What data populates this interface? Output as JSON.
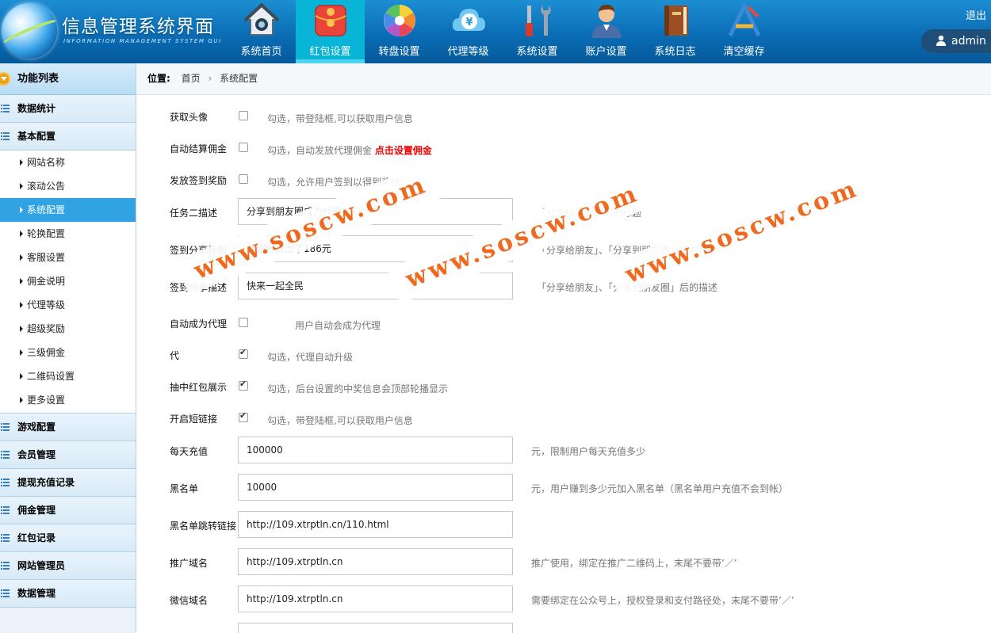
{
  "header": {
    "title": "信息管理系统界面",
    "subtitle": "INFORMATION MANAGEMENT SYSTEM GUI",
    "logout": "退出",
    "user": "admin",
    "nav": [
      {
        "label": "系统首页",
        "icon": "home-icon"
      },
      {
        "label": "红包设置",
        "icon": "red-envelope-icon"
      },
      {
        "label": "转盘设置",
        "icon": "wheel-icon"
      },
      {
        "label": "代理等级",
        "icon": "yen-cloud-icon"
      },
      {
        "label": "系统设置",
        "icon": "tools-icon"
      },
      {
        "label": "账户设置",
        "icon": "user-icon"
      },
      {
        "label": "系统日志",
        "icon": "book-icon"
      },
      {
        "label": "清空缓存",
        "icon": "clear-icon"
      }
    ]
  },
  "sidebar": {
    "head": "功能列表",
    "sections": [
      "数据统计",
      "基本配置",
      "游戏配置",
      "会员管理",
      "提现充值记录",
      "佣金管理",
      "红包记录",
      "网站管理员",
      "数据管理"
    ],
    "sub_items": [
      "网站名称",
      "滚动公告",
      "系统配置",
      "轮换配置",
      "客服设置",
      "佣金说明",
      "代理等级",
      "超级奖励",
      "三级佣金",
      "二维码设置",
      "更多设置"
    ]
  },
  "breadcrumb": {
    "label": "位置:",
    "home": "首页",
    "current": "系统配置"
  },
  "form": {
    "avatar_label": "获取头像",
    "avatar_hint": "勾选，带登陆框,可以获取用户信息",
    "commission_label": "自动结算佣金",
    "commission_hint": "勾选，自动发放代理佣金",
    "commission_link": "点击设置佣金",
    "signin_label": "发放签到奖励",
    "signin_hint": "勾选，允许用户签到以得到奖励",
    "task_desc_label": "任务二描述",
    "task_desc_value": "分享到朋友圈成为代理",
    "task_desc_hint": "「分享给朋友」后的标题",
    "share_title_label": "签到分享标题",
    "share_title_value": "我刚刚拆出了186元",
    "share_title_hint": "「分享给朋友」、「分享到朋友圈」后的标题",
    "share_desc_label": "签到分享描述",
    "share_desc_value": "快来一起全民",
    "share_desc_hint": "「分享给朋友」、「分享到朋友圈」后的描述",
    "auto_agent_label": "自动成为代理",
    "auto_agent_hint": "用户自动会成为代理",
    "upgrade_label": "代",
    "upgrade_hint": "勾选，代理自动升级",
    "prize_label": "抽中红包展示",
    "prize_hint": "勾选，后台设置的中奖信息会顶部轮播显示",
    "shortlink_label": "开启短链接",
    "shortlink_hint": "勾选，带登陆框,可以获取用户信息",
    "daily_label": "每天充值",
    "daily_value": "100000",
    "daily_hint": "元，限制用户每天充值多少",
    "blacklist_label": "黑名单",
    "blacklist_value": "10000",
    "blacklist_hint": "元，用户赚到多少元加入黑名单（黑名单用户充值不会到帐）",
    "blacklink_label": "黑名单跳转链接",
    "blacklink_value": "http://109.xtrptln.cn/110.html",
    "promo_label": "推广域名",
    "promo_value": "http://109.xtrptln.cn",
    "promo_hint": "推广使用，绑定在推广二维码上，末尾不要带’／’",
    "wechat_label": "微信域名",
    "wechat_value": "http://109.xtrptln.cn",
    "wechat_hint": "需要绑定在公众号上，授权登录和支付路径处，末尾不要带’／’"
  },
  "watermark": [
    "www.soscw.com",
    "www.soscw.com",
    "www.soscw.com"
  ],
  "colors": {
    "header": "#0a6db5",
    "nav_active": "#08b5d6",
    "sidebar_active": "#31a3e3",
    "watermark": "#ef6a1e",
    "link_red": "#ee0000"
  }
}
